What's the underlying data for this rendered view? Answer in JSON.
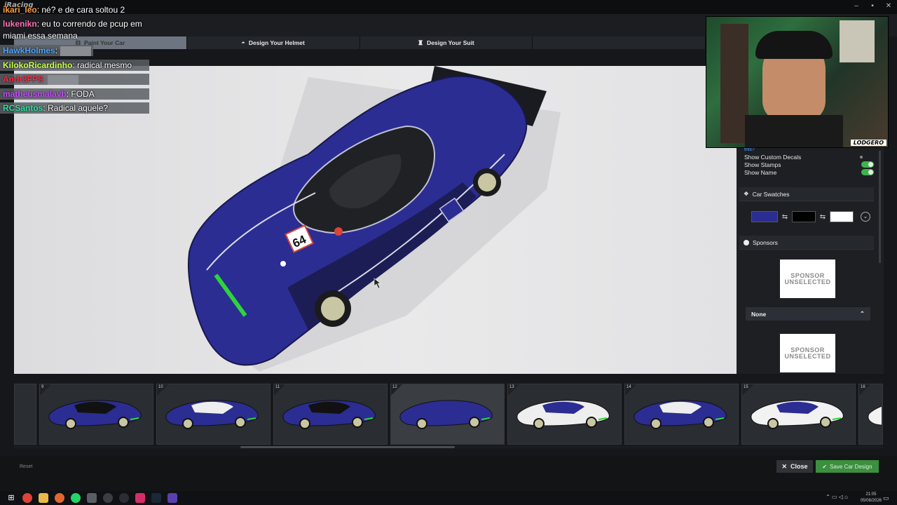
{
  "app": {
    "logo": "iRacing"
  },
  "window_controls": {
    "minimize": "–",
    "maximize": "▪",
    "close": "✕"
  },
  "tabs": [
    {
      "label": "Paint Your Car",
      "icon": "⊟"
    },
    {
      "label": "Design Your Helmet",
      "icon": "◓"
    },
    {
      "label": "Design Your Suit",
      "icon": "♜"
    },
    {
      "label": "",
      "icon": ""
    }
  ],
  "chat": [
    {
      "user": "ikari_leo",
      "text": ": né? e de cara soltou 2",
      "color": "#ff9a3c"
    },
    {
      "user": "lukenikn",
      "text": ": eu to correndo de pcup em",
      "color": "#ff6fb5"
    },
    {
      "user": "",
      "text": "miami essa semana",
      "color": "#ffffff"
    },
    {
      "user": "HawkHolmes",
      "text": ":",
      "color": "#4fa3ff"
    },
    {
      "user": "KilokoRicardinho",
      "text": ": radical mesmo",
      "color": "#c7ff4d"
    },
    {
      "user": "Andr3FPS",
      "text": "",
      "color": "#ff2a4a"
    },
    {
      "user": "matheusmalavb",
      "text": ": FODA",
      "color": "#c54dff"
    },
    {
      "user": "RCSantos",
      "text": ": Radical aquele?",
      "color": "#2fe0a0"
    }
  ],
  "right_panel": {
    "partial_label": "this?",
    "toggles": [
      {
        "label": "Show Custom Decals",
        "on": false
      },
      {
        "label": "Show Stamps",
        "on": true
      },
      {
        "label": "Show Name",
        "on": true
      }
    ],
    "swatches_title": "Car Swatches",
    "swatch_colors": [
      "#2b2d92",
      "#000000",
      "#ffffff"
    ],
    "sponsors_title": "Sponsors",
    "sponsor_placeholder": "SPONSOR\nUNSELECTED",
    "sponsor_select": "None"
  },
  "webcam": {
    "tag": "LODGERO"
  },
  "filmstrip": {
    "thumbs": [
      {
        "num": "9",
        "livery": "blue-black"
      },
      {
        "num": "10",
        "livery": "blue-white"
      },
      {
        "num": "11",
        "livery": "blue-black-stripe"
      },
      {
        "num": "12",
        "livery": "blue",
        "selected": true
      },
      {
        "num": "13",
        "livery": "white-blue"
      },
      {
        "num": "14",
        "livery": "blue-white-center"
      },
      {
        "num": "15",
        "livery": "white"
      },
      {
        "num": "16",
        "livery": "white-partial"
      }
    ],
    "scroll_position": 0.26
  },
  "bottom": {
    "reset": "Reset",
    "close": "Close",
    "save": "Save Car Design"
  },
  "taskbar": {
    "time": "21:05",
    "date": "05/08/2026"
  },
  "car": {
    "number": "64",
    "body_color": "#2b2d92",
    "accent_color": "#2ed53a"
  }
}
